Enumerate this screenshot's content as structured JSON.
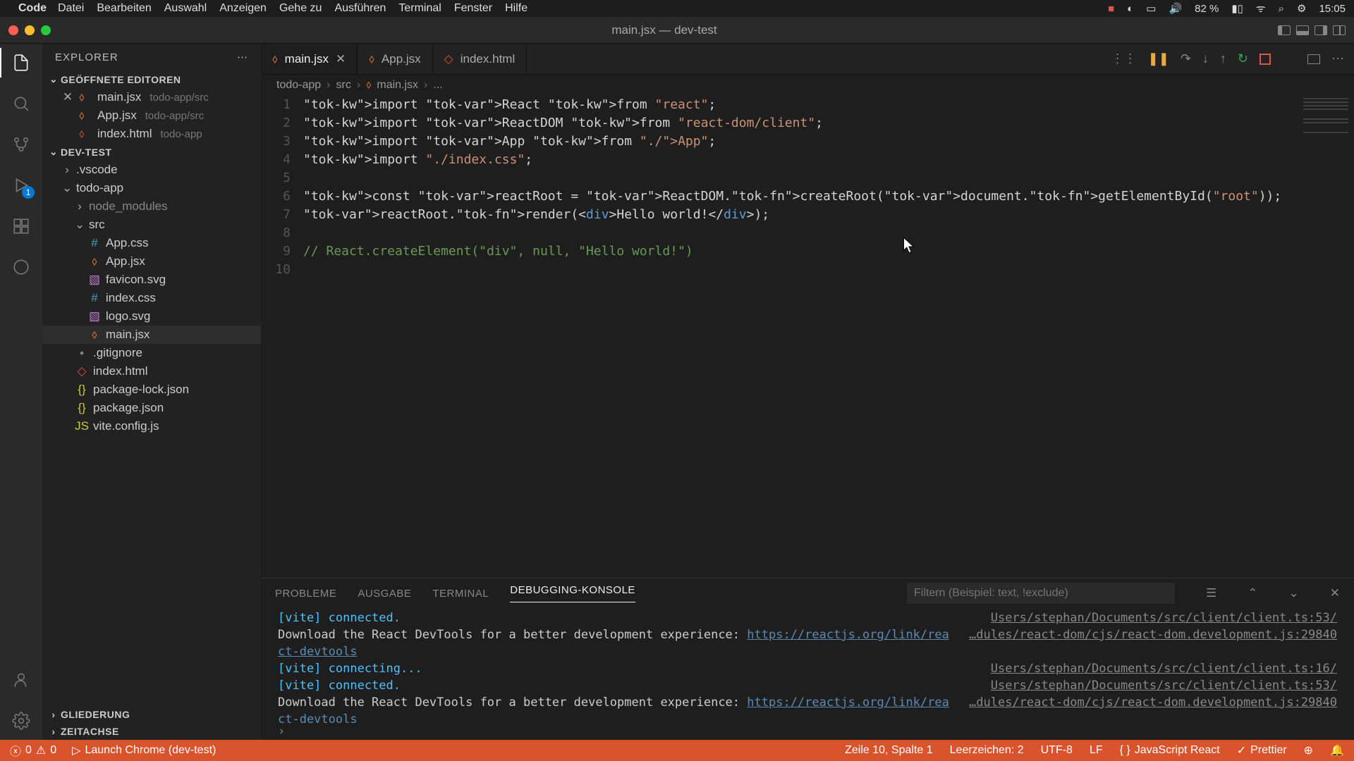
{
  "mac_menu": {
    "app": "Code",
    "items": [
      "Datei",
      "Bearbeiten",
      "Auswahl",
      "Anzeigen",
      "Gehe zu",
      "Ausführen",
      "Terminal",
      "Fenster",
      "Hilfe"
    ],
    "battery": "82 %",
    "clock": "15:05"
  },
  "window_title": "main.jsx — dev-test",
  "activity_badge": "1",
  "sidebar": {
    "title": "EXPLORER",
    "sections": {
      "open_editors": "GEÖFFNETE EDITOREN",
      "project": "DEV-TEST",
      "outline": "GLIEDERUNG",
      "timeline": "ZEITACHSE"
    },
    "open_editors_list": [
      {
        "name": "main.jsx",
        "path": "todo-app/src",
        "active": true,
        "icon": "jsx"
      },
      {
        "name": "App.jsx",
        "path": "todo-app/src",
        "active": false,
        "icon": "jsx"
      },
      {
        "name": "index.html",
        "path": "todo-app",
        "active": false,
        "icon": "html"
      }
    ],
    "tree": {
      "vscode": ".vscode",
      "todo_app": "todo-app",
      "node_modules": "node_modules",
      "src": "src",
      "files": {
        "app_css": "App.css",
        "app_jsx": "App.jsx",
        "favicon": "favicon.svg",
        "index_css": "index.css",
        "logo": "logo.svg",
        "main_jsx": "main.jsx",
        "gitignore": ".gitignore",
        "index_html": "index.html",
        "pkg_lock": "package-lock.json",
        "pkg": "package.json",
        "vite": "vite.config.js"
      }
    }
  },
  "tabs": [
    {
      "name": "main.jsx",
      "icon": "jsx",
      "active": true
    },
    {
      "name": "App.jsx",
      "icon": "jsx",
      "active": false
    },
    {
      "name": "index.html",
      "icon": "html",
      "active": false
    }
  ],
  "breadcrumb": [
    "todo-app",
    "src",
    "main.jsx",
    "..."
  ],
  "code": {
    "line_count": 10,
    "lines": [
      "import React from \"react\";",
      "import ReactDOM from \"react-dom/client\";",
      "import App from \"./App\";",
      "import \"./index.css\";",
      "",
      "const reactRoot = ReactDOM.createRoot(document.getElementById(\"root\"));",
      "reactRoot.render(<div>Hello world!</div>);",
      "",
      "// React.createElement(\"div\", null, \"Hello world!\")",
      ""
    ]
  },
  "panel": {
    "tabs": {
      "problems": "PROBLEME",
      "output": "AUSGABE",
      "terminal": "TERMINAL",
      "debug": "DEBUGGING-KONSOLE"
    },
    "filter_placeholder": "Filtern (Beispiel: text, !exclude)",
    "lines": [
      {
        "msg_parts": [
          {
            "t": "[vite] connected.",
            "c": "vite"
          }
        ],
        "loc": "Users/stephan/Documents/src/client/client.ts:53/"
      },
      {
        "msg_parts": [
          {
            "t": "Download the React DevTools for a better development experience: ",
            "c": ""
          },
          {
            "t": "https://reactjs.org/link/rea",
            "c": "url"
          }
        ],
        "loc": "…dules/react-dom/cjs/react-dom.development.js:29840"
      },
      {
        "msg_parts": [
          {
            "t": "ct-devtools",
            "c": "url"
          }
        ],
        "loc": ""
      },
      {
        "msg_parts": [
          {
            "t": "[vite] connecting...",
            "c": "vite"
          }
        ],
        "loc": "Users/stephan/Documents/src/client/client.ts:16/"
      },
      {
        "msg_parts": [
          {
            "t": "[vite] connected.",
            "c": "vite"
          }
        ],
        "loc": "Users/stephan/Documents/src/client/client.ts:53/"
      },
      {
        "msg_parts": [
          {
            "t": "Download the React DevTools for a better development experience: ",
            "c": ""
          },
          {
            "t": "https://reactjs.org/link/rea",
            "c": "url"
          }
        ],
        "loc": "…dules/react-dom/cjs/react-dom.development.js:29840"
      },
      {
        "msg_parts": [
          {
            "t": "ct-devtools",
            "c": "url"
          }
        ],
        "loc": ""
      }
    ]
  },
  "statusbar": {
    "errors": "0",
    "warnings": "0",
    "launch": "Launch Chrome (dev-test)",
    "position": "Zeile 10, Spalte 1",
    "spaces": "Leerzeichen: 2",
    "encoding": "UTF-8",
    "eol": "LF",
    "lang": "JavaScript React",
    "prettier": "Prettier"
  }
}
